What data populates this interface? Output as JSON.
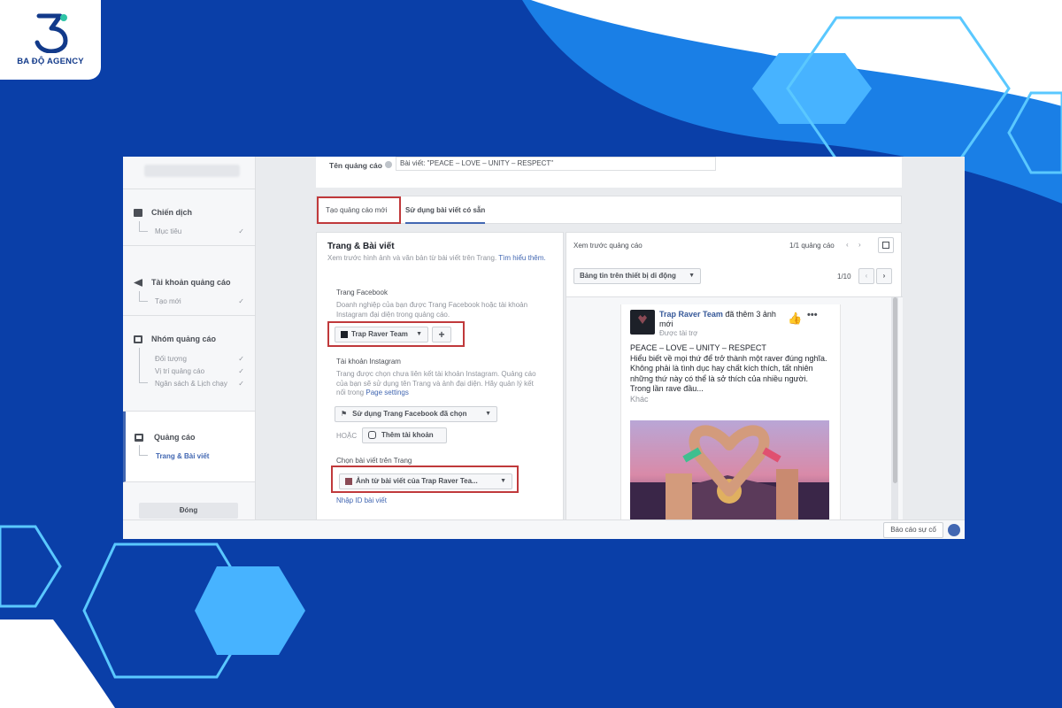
{
  "brand": {
    "name": "BA ĐỘ AGENCY"
  },
  "left_nav": {
    "sections": [
      {
        "title": "Chiến dịch",
        "subs": [
          "Mục tiêu"
        ]
      },
      {
        "title": "Tài khoản quảng cáo",
        "subs": [
          "Tạo mới"
        ]
      },
      {
        "title": "Nhóm quảng cáo",
        "subs": [
          "Đối tượng",
          "Vị trí quảng cáo",
          "Ngân sách & Lịch chạy"
        ]
      },
      {
        "title": "Quảng cáo",
        "subs": [
          "Trang & Bài viết"
        ]
      }
    ],
    "close_label": "Đóng"
  },
  "ad_name": {
    "label": "Tên quảng cáo",
    "value": "Bài viết: \"PEACE – LOVE – UNITY – RESPECT\""
  },
  "tabs": {
    "create_new": "Tạo quảng cáo mới",
    "use_existing": "Sử dụng bài viết có sẵn"
  },
  "page_posts": {
    "title": "Trang & Bài viết",
    "desc": "Xem trước hình ảnh và văn bản từ bài viết trên Trang.",
    "learn_more": "Tìm hiểu thêm.",
    "fb_page_label": "Trang Facebook",
    "fb_page_desc": "Doanh nghiệp của bạn được Trang Facebook hoặc tài khoản Instagram đại diện trong quảng cáo.",
    "fb_page_value": "Trap Raver Team",
    "ig_label": "Tài khoản Instagram",
    "ig_desc": "Trang được chọn chưa liên kết tài khoản Instagram. Quảng cáo của bạn sẽ sử dụng tên Trang và ảnh đại diện. Hãy quản lý kết nối trong",
    "page_settings": "Page settings",
    "ig_select": "Sử dụng Trang Facebook đã chọn",
    "or": "HOẶC",
    "add_account": "Thêm tài khoản",
    "choose_post_label": "Chọn bài viết trên Trang",
    "post_select": "Ảnh từ bài viết của Trap Raver Tea...",
    "enter_post_id": "Nhập ID bài viết"
  },
  "preview": {
    "title": "Xem trước quảng cáo",
    "count": "1/1 quảng cáo",
    "placement": "Bảng tin trên thiết bị di động",
    "pager": "1/10",
    "post_author": "Trap Raver Team",
    "post_action": " đã thêm 3 ảnh mới",
    "sponsored": "Được tài trợ",
    "post_headline": "PEACE – LOVE – UNITY – RESPECT",
    "post_body": "Hiểu biết về mọi thứ để trở thành một raver đúng nghĩa. Không phải là tình dục hay chất kích thích, tất nhiên những thứ này có thể là sở thích của nhiều người. Trong lần rave đầu...",
    "more": "Khác"
  },
  "footer": {
    "report": "Báo cáo sự cố"
  },
  "colors": {
    "background": "#0a3fa8",
    "fb_blue": "#4267b2",
    "highlight": "#c0393b"
  }
}
